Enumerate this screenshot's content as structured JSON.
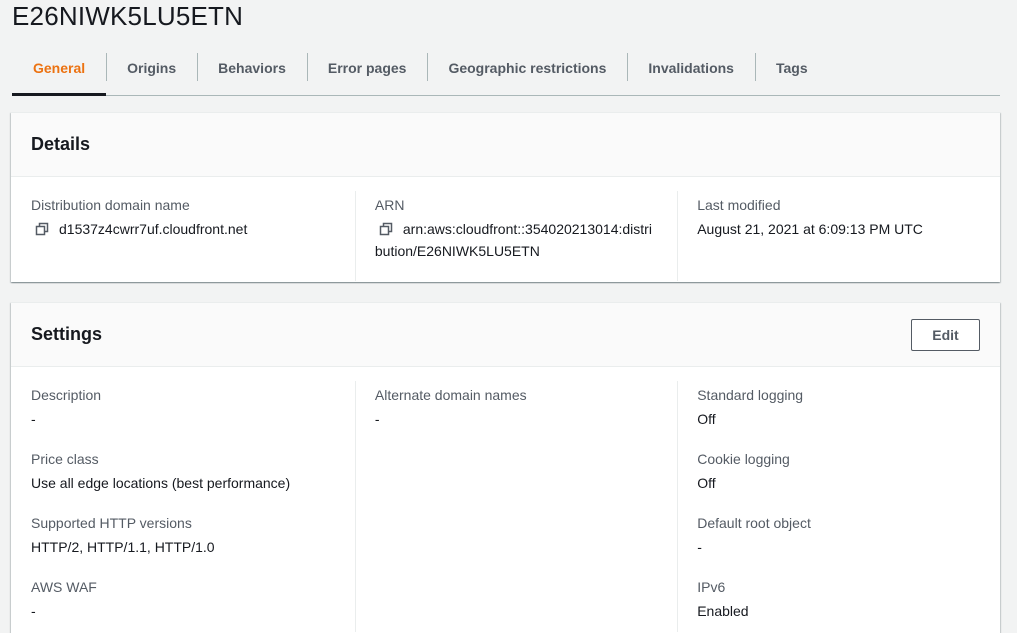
{
  "page": {
    "title": "E26NIWK5LU5ETN"
  },
  "tabs": [
    {
      "label": "General",
      "active": true
    },
    {
      "label": "Origins",
      "active": false
    },
    {
      "label": "Behaviors",
      "active": false
    },
    {
      "label": "Error pages",
      "active": false
    },
    {
      "label": "Geographic restrictions",
      "active": false
    },
    {
      "label": "Invalidations",
      "active": false
    },
    {
      "label": "Tags",
      "active": false
    }
  ],
  "details": {
    "title": "Details",
    "domain_label": "Distribution domain name",
    "domain_value": "d1537z4cwrr7uf.cloudfront.net",
    "arn_label": "ARN",
    "arn_value_line1": "arn:aws:cloudfront::354020213014:distri",
    "arn_value_line2": "bution/E26NIWK5LU5ETN",
    "modified_label": "Last modified",
    "modified_value": "August 21, 2021 at 6:09:13 PM UTC",
    "copy_icon": "copy-icon"
  },
  "settings": {
    "title": "Settings",
    "edit_label": "Edit",
    "description_label": "Description",
    "description_value": "-",
    "price_class_label": "Price class",
    "price_class_value": "Use all edge locations (best performance)",
    "http_versions_label": "Supported HTTP versions",
    "http_versions_value": "HTTP/2, HTTP/1.1, HTTP/1.0",
    "waf_label": "AWS WAF",
    "waf_value": "-",
    "alt_domains_label": "Alternate domain names",
    "alt_domains_value": "-",
    "std_logging_label": "Standard logging",
    "std_logging_value": "Off",
    "cookie_logging_label": "Cookie logging",
    "cookie_logging_value": "Off",
    "root_object_label": "Default root object",
    "root_object_value": "-",
    "ipv6_label": "IPv6",
    "ipv6_value": "Enabled"
  },
  "colors": {
    "accent": "#ec7211",
    "background": "#f2f3f3",
    "text": "#16191f",
    "secondary_text": "#545b64"
  }
}
